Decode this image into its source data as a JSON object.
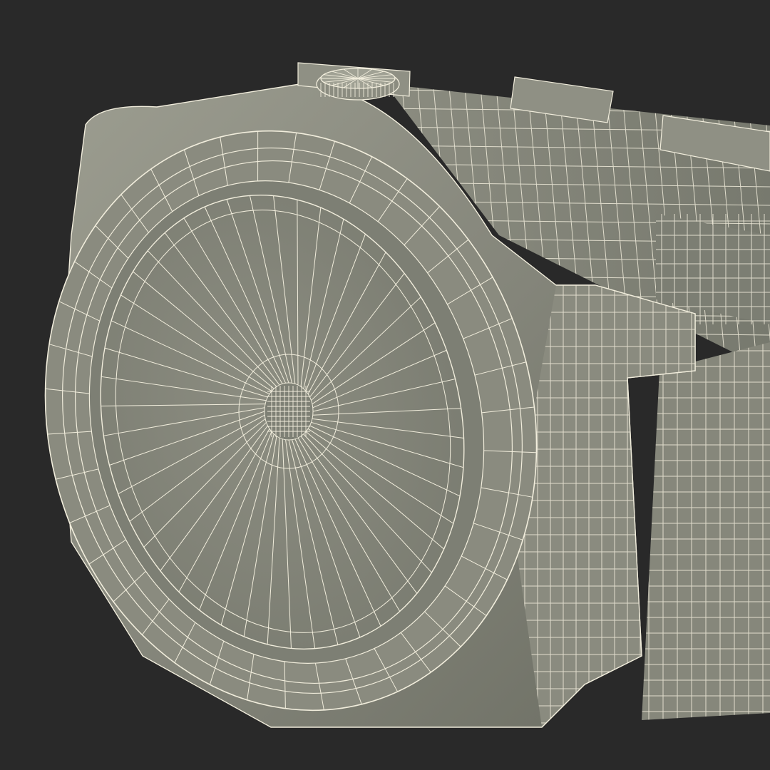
{
  "scene": {
    "subject": "3d-wristwatch-wireframe",
    "colors": {
      "background": "#292929",
      "surface": "#84857a",
      "surface_light": "#a1a295",
      "surface_dark": "#686a5f",
      "wire": "#f1eddc"
    }
  }
}
